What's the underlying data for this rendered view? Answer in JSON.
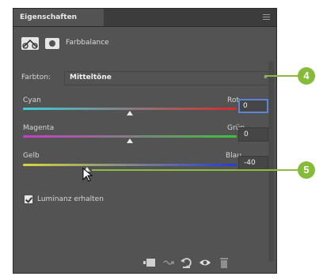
{
  "panel": {
    "tab_title": "Eigenschaften",
    "header_title": "Farbbalance"
  },
  "tone": {
    "label": "Farbton:",
    "value": "Mitteltöne"
  },
  "sliders": [
    {
      "left_label": "Cyan",
      "right_label": "Rot",
      "value": "0",
      "position": 0.5,
      "gradient": [
        "#39d0d8",
        "#d62a2a"
      ]
    },
    {
      "left_label": "Magenta",
      "right_label": "Grün",
      "value": "0",
      "position": 0.5,
      "gradient": [
        "#c73cc7",
        "#3cc23c"
      ]
    },
    {
      "left_label": "Gelb",
      "right_label": "Blau",
      "value": "-40",
      "position": 0.3,
      "gradient": [
        "#d8d83a",
        "#2a3ad6"
      ]
    }
  ],
  "preserve_luminosity": {
    "label": "Luminanz erhalten",
    "checked": true
  },
  "callouts": [
    "4",
    "5"
  ],
  "icons": {
    "menu": "panel-menu-icon",
    "adjustment": "color-balance-icon",
    "mask": "mask-icon",
    "footer": [
      "clip-to-layer-icon",
      "view-previous-icon",
      "reset-icon",
      "visibility-icon",
      "trash-icon"
    ]
  },
  "colors": {
    "panel_bg": "#535353",
    "focus_border": "#5a86d8",
    "callout": "#86bb3a"
  }
}
